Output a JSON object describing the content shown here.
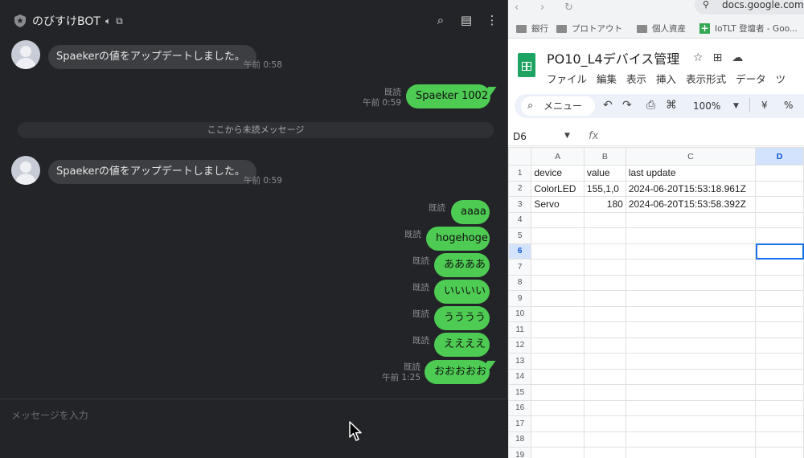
{
  "chat": {
    "title": "のびすけBOT",
    "input_placeholder": "メッセージを入力",
    "unread_divider": "ここから未読メッセージ",
    "incoming": [
      {
        "text": "Spaekerの値をアップデートしました。",
        "time": "午前 0:58"
      },
      {
        "text": "Spaekerの値をアップデートしました。",
        "time": "午前 0:59"
      }
    ],
    "outgoing_first": {
      "text": "Spaeker 1002",
      "read": "既読",
      "time": "午前 0:59"
    },
    "outgoing": [
      {
        "text": "aaaa",
        "read": "既読",
        "time": ""
      },
      {
        "text": "hogehoge",
        "read": "既読",
        "time": ""
      },
      {
        "text": "ああああ",
        "read": "既読",
        "time": ""
      },
      {
        "text": "いいいい",
        "read": "既読",
        "time": ""
      },
      {
        "text": "うううう",
        "read": "既読",
        "time": ""
      },
      {
        "text": "ええええ",
        "read": "既読",
        "time": ""
      },
      {
        "text": "おおおおお",
        "read": "既読",
        "time": "午前 1:25"
      }
    ]
  },
  "browser": {
    "url": "docs.google.com",
    "bookmarks": [
      "銀行",
      "プロトアウト",
      "個人資産",
      "IoTLT 登壇者 - Goo..."
    ]
  },
  "sheet": {
    "title": "PO10_L4デバイス管理",
    "menus": [
      "ファイル",
      "編集",
      "表示",
      "挿入",
      "表示形式",
      "データ",
      "ツ"
    ],
    "search_label": "メニュー",
    "zoom": "100%",
    "currency": "¥",
    "percent": "%",
    "name_box": "D6",
    "fx": "fx",
    "columns": [
      "A",
      "B",
      "C",
      "D"
    ],
    "rows": [
      [
        "device",
        "value",
        "last update",
        ""
      ],
      [
        "ColorLED",
        "155,1,0",
        "2024-06-20T15:53:18.961Z",
        ""
      ],
      [
        "Servo",
        "180",
        "2024-06-20T15:53:58.392Z",
        ""
      ],
      [
        "",
        "",
        "",
        ""
      ],
      [
        "",
        "",
        "",
        ""
      ],
      [
        "",
        "",
        "",
        ""
      ],
      [
        "",
        "",
        "",
        ""
      ],
      [
        "",
        "",
        "",
        ""
      ],
      [
        "",
        "",
        "",
        ""
      ],
      [
        "",
        "",
        "",
        ""
      ],
      [
        "",
        "",
        "",
        ""
      ],
      [
        "",
        "",
        "",
        ""
      ],
      [
        "",
        "",
        "",
        ""
      ],
      [
        "",
        "",
        "",
        ""
      ],
      [
        "",
        "",
        "",
        ""
      ],
      [
        "",
        "",
        "",
        ""
      ],
      [
        "",
        "",
        "",
        ""
      ],
      [
        "",
        "",
        "",
        ""
      ],
      [
        "",
        "",
        "",
        ""
      ]
    ],
    "active_cell": "D6",
    "selection_color": "#1a73e8"
  }
}
